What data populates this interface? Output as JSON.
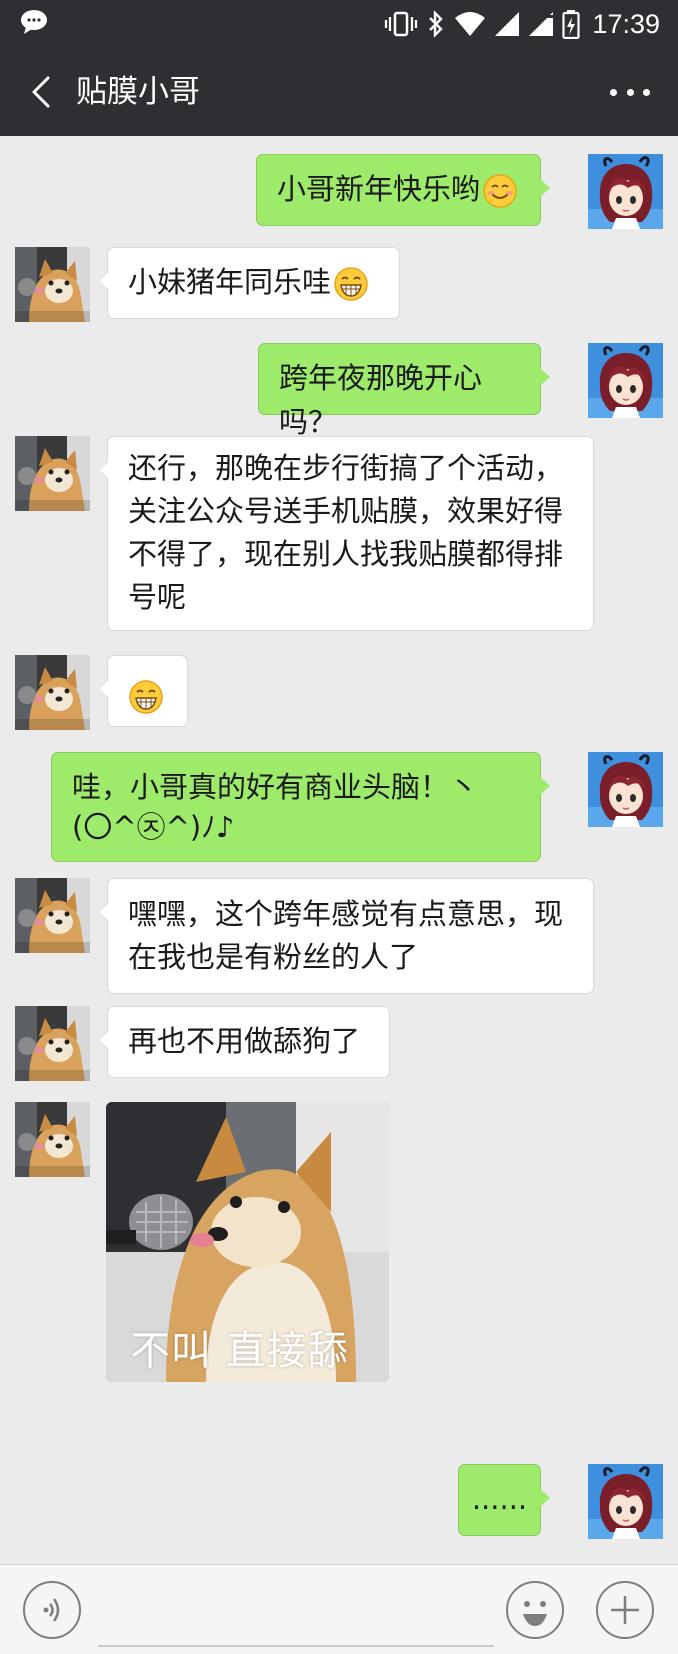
{
  "status_bar": {
    "time": "17:39"
  },
  "header": {
    "title": "贴膜小哥"
  },
  "messages": [
    {
      "from": "me",
      "text": "小哥新年快乐哟",
      "emoji": "smiling-emoji"
    },
    {
      "from": "contact",
      "text": "小妹猪年同乐哇",
      "emoji": "grinning-emoji"
    },
    {
      "from": "me",
      "text": "跨年夜那晚开心吗？"
    },
    {
      "from": "contact",
      "lines": [
        "还行，那晚在步行街搞了个活动，",
        "关注公众号送手机贴膜，效果好得",
        "不得了，现在别人找我贴膜都得排",
        "号呢"
      ]
    },
    {
      "from": "contact",
      "emoji": "grinning-emoji"
    },
    {
      "from": "me",
      "lines": [
        "哇，小哥真的好有商业头脑！丶",
        "(〇^㉨^)ﾉ♪"
      ]
    },
    {
      "from": "contact",
      "lines": [
        "嘿嘿，这个跨年感觉有点意思，现",
        "在我也是有粉丝的人了"
      ]
    },
    {
      "from": "contact",
      "text": "再也不用做舔狗了"
    },
    {
      "from": "contact",
      "sticker_caption": "不叫 直接舔"
    },
    {
      "from": "me",
      "text": "......"
    }
  ],
  "contact_avatar_caption": "不叫 直接舔",
  "input_bar": {
    "placeholder": ""
  },
  "colors": {
    "header_bg": "#2e2f33",
    "chat_bg": "#ebebeb",
    "outgoing_bubble": "#9eea6a",
    "incoming_bubble": "#ffffff"
  }
}
